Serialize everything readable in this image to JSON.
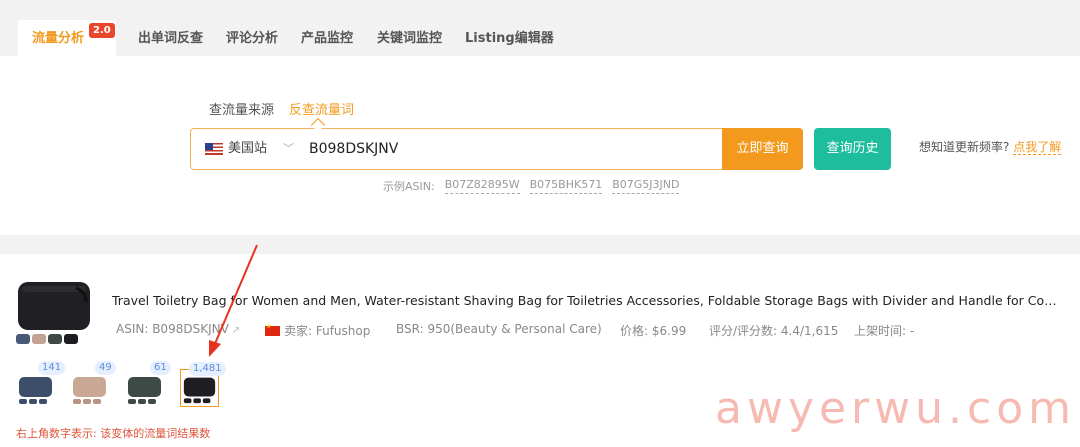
{
  "tabs": [
    {
      "label": "流量分析",
      "active": true,
      "badge": "2.0"
    },
    {
      "label": "出单词反查",
      "active": false
    },
    {
      "label": "评论分析",
      "active": false
    },
    {
      "label": "产品监控",
      "active": false
    },
    {
      "label": "关键词监控",
      "active": false
    },
    {
      "label": "Listing编辑器",
      "active": false
    }
  ],
  "search": {
    "modes": [
      "查流量来源",
      "反查流量词"
    ],
    "active_mode": "反查流量词",
    "site": "美国站",
    "value": "B098DSKJNV",
    "submit_label": "立即查询",
    "history_label": "查询历史",
    "update_question": "想知道更新频率?",
    "update_link": "点我了解",
    "examples_label": "示例ASIN:",
    "examples": [
      "B07Z82895W",
      "B075BHK571",
      "B07G5J3JND"
    ]
  },
  "product": {
    "title": "Travel Toiletry Bag for Women and Men, Water-resistant Shaving Bag for Toiletries Accessories, Foldable Storage Bags with Divider and Handle for Cosmetics",
    "asin": "ASIN: B098DSKJNV",
    "seller": "卖家: Fufushop",
    "bsr": "BSR: 950(Beauty & Personal Care)",
    "price": "价格: $6.99",
    "rating": "评分/评分数: 4.4/1,615",
    "listed": "上架时间: -",
    "variants": [
      {
        "count": "141",
        "color": "#3d4e6b"
      },
      {
        "count": "49",
        "color": "#c9a895"
      },
      {
        "count": "61",
        "color": "#3e4a46"
      },
      {
        "count": "1,481",
        "color": "#1d1d22",
        "selected": true
      }
    ],
    "hint": "右上角数字表示: 该变体的流量词结果数"
  },
  "watermark": "awyerwu.com",
  "colors": {
    "accent": "#f39a1e",
    "teal": "#1dbd9e",
    "badge": "#e8472b",
    "hint": "#e0543a"
  }
}
